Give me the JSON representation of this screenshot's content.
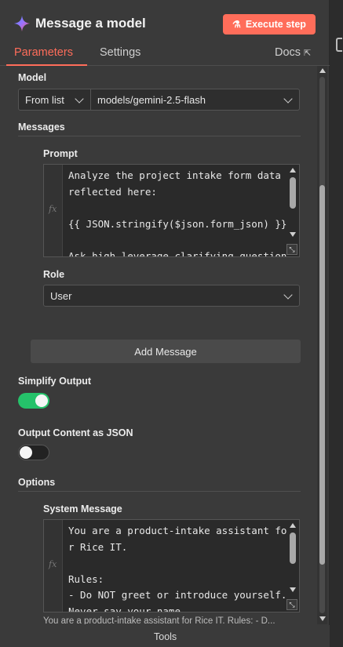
{
  "header": {
    "title": "Message a model",
    "execute_label": "Execute step"
  },
  "tabs": {
    "parameters": "Parameters",
    "settings": "Settings",
    "docs": "Docs"
  },
  "model": {
    "label": "Model",
    "mode": "From list",
    "value": "models/gemini-2.5-flash"
  },
  "messages": {
    "label": "Messages",
    "prompt_label": "Prompt",
    "prompt_text": "Analyze the project intake form data reflected here:\n\n{{ JSON.stringify($json.form_json) }}\n\nAsk high-leverage clarifying questions",
    "role_label": "Role",
    "role_value": "User",
    "add_message": "Add Message"
  },
  "simplify_output": {
    "label": "Simplify Output",
    "enabled": true
  },
  "output_json": {
    "label": "Output Content as JSON",
    "enabled": false
  },
  "options": {
    "label": "Options",
    "system_message_label": "System Message",
    "system_message_text": "You are a product-intake assistant for Rice IT.\n\nRules:\n- Do NOT greet or introduce yourself. Never say your name",
    "preview": "You are a product-intake assistant for Rice IT. Rules: - D..."
  },
  "footer": {
    "tools": "Tools"
  },
  "colors": {
    "accent": "#ff6d5a",
    "toggle_on": "#25c26a"
  }
}
